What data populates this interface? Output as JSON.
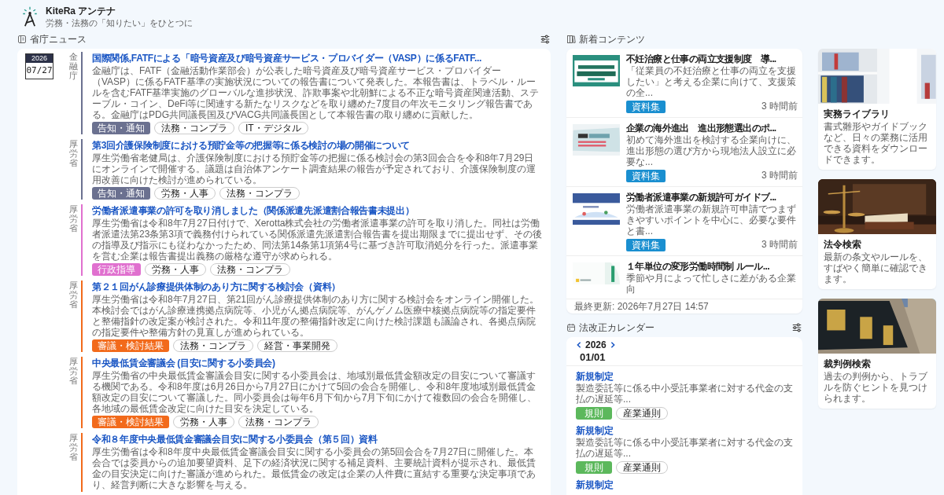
{
  "header": {
    "title": "KiteRa アンテナ",
    "subtitle": "労務・法務の「知りたい」をひとつに"
  },
  "news": {
    "heading": "省庁ニュース",
    "items": [
      {
        "date": {
          "year": "2026",
          "day": "07/27"
        },
        "agency": "金融庁",
        "color": "#6b7190",
        "title": "国際関係,FATFによる「暗号資産及び暗号資産サービス・プロバイダー（VASP）に係るFATF...",
        "summary": "金融庁は、FATF（金融活動作業部会）が公表した暗号資産及び暗号資産サービス・プロバイダー（VASP）に係るFATF基準の実施状況についての報告書について発表した。本報告書は、トラベル・ルールを含むFATF基準実施のグローバルな進捗状況、詐欺事案や北朝鮮による不正な暗号資産関連活動、ステーブル・コイン、DeFi等に関連する新たなリスクなどを取り纏めた7度目の年次モニタリング報告書である。金融庁はPDG共同議長国及びVACG共同議長国として本報告書の取り纏めに貢献した。",
        "tags": [
          {
            "label": "告知・通知",
            "kind": "category"
          },
          {
            "label": "法務・コンプラ",
            "kind": "topic"
          },
          {
            "label": "IT・デジタル",
            "kind": "topic"
          }
        ]
      },
      {
        "agency": "厚労省",
        "color": "#6b7190",
        "title": "第3回介護保険制度における預貯金等の把握等に係る検討の場の開催について",
        "summary": "厚生労働省老健局は、介護保険制度における預貯金等の把握に係る検討会の第3回会合を令和8年7月29日にオンラインで開催する。議題は自治体アンケート調査結果の報告が予定されており、介護保険制度の運用改善に向けた検討が進められている。",
        "tags": [
          {
            "label": "告知・通知",
            "kind": "category"
          },
          {
            "label": "労務・人事",
            "kind": "topic"
          },
          {
            "label": "法務・コンプラ",
            "kind": "topic"
          }
        ]
      },
      {
        "agency": "厚労省",
        "color": "#e070cf",
        "title": "労働者派遣事業の許可を取り消しました（関係派遣先派遣割合報告書未提出）",
        "summary": "厚生労働省は令和8年7月27日付けで、Xerotta株式会社の労働者派遣事業の許可を取り消した。同社は労働者派遣法第23条第3項で義務付けられている関係派遣先派遣割合報告書を提出期限までに提出せず、その後の指導及び指示にも従わなかったため、同法第14条第1項第4号に基づき許可取消処分を行った。派遣事業を営む企業は報告書提出義務の厳格な遵守が求められる。",
        "tags": [
          {
            "label": "行政指導",
            "kind": "category"
          },
          {
            "label": "労務・人事",
            "kind": "topic"
          },
          {
            "label": "法務・コンプラ",
            "kind": "topic"
          }
        ]
      },
      {
        "agency": "厚労省",
        "color": "#f26a1b",
        "title": "第２１回がん診療提供体制のあり方に関する検討会（資料）",
        "summary": "厚生労働省は令和8年7月27日、第21回がん診療提供体制のあり方に関する検討会をオンライン開催した。本検討会ではがん診療連携拠点病院等、小児がん拠点病院等、がんゲノム医療中核拠点病院等の指定要件と整備指針の改定案が検討された。令和11年度の整備指針改定に向けた検討課題も議論され、各拠点病院の指定要件や整備方針の見直しが進められている。",
        "tags": [
          {
            "label": "審議・検討結果",
            "kind": "category"
          },
          {
            "label": "法務・コンプラ",
            "kind": "topic"
          },
          {
            "label": "経営・事業開発",
            "kind": "topic"
          }
        ]
      },
      {
        "agency": "厚労省",
        "color": "#f26a1b",
        "title": "中央最低賃金審議会 (目安に関する小委員会)",
        "summary": "厚生労働省の中央最低賃金審議会目安に関する小委員会は、地域別最低賃金額改定の目安について審議する機関である。令和8年度は6月26日から7月27日にかけて5回の会合を開催し、令和8年度地域別最低賃金額改定の目安について審議した。同小委員会は毎年6月下旬から7月下旬にかけて複数回の会合を開催し、各地域の最低賃金改定に向けた目安を決定している。",
        "tags": [
          {
            "label": "審議・検討結果",
            "kind": "category"
          },
          {
            "label": "労務・人事",
            "kind": "topic"
          },
          {
            "label": "法務・コンプラ",
            "kind": "topic"
          }
        ]
      },
      {
        "agency": "厚労省",
        "color": "#f26a1b",
        "title": "令和８年度中央最低賃金審議会目安に関する小委員会（第５回）資料",
        "summary": "厚生労働省は令和8年度中央最低賃金審議会目安に関する小委員会の第5回会合を7月27日に開催した。本会合では委員からの追加要望資料、足下の経済状況に関する補足資料、主要統計資料が提示され、最低賃金の目安決定に向けた審議が進められた。最低賃金の改定は企業の人件費に直結する重要な決定事項であり、経営判断に大きな影響を与える。"
      }
    ]
  },
  "contents": {
    "heading": "新着コンテンツ",
    "items": [
      {
        "title": "不妊治療と仕事の両立支援制度　導...",
        "summary": "「従業員の不妊治療と仕事の両立を支援したい」と考える企業に向けて、支援策の全...",
        "tag": "資料集",
        "time": "3 時間前"
      },
      {
        "title": "企業の海外進出　進出形態選出のポ...",
        "summary": "初めて海外進出を検討する企業向けに、進出形態の選び方から現地法人設立に必要な...",
        "tag": "資料集",
        "time": "3 時間前"
      },
      {
        "title": "労働者派遣事業の新規許可ガイドブ...",
        "summary": "労働者派遣事業の新規許可申請でつまずきやすいポイントを中心に、必要な要件と書...",
        "tag": "資料集",
        "time": "3 時間前"
      },
      {
        "title": "１年単位の変形労働時間制 ルール...",
        "summary": "季節や月によって忙しさに差がある企業向"
      }
    ],
    "updated": "最終更新: 2026年7月27日 14:57"
  },
  "calendar": {
    "heading": "法改正カレンダー",
    "year": "2026",
    "date": "01/01",
    "entries": [
      {
        "title": "新規制定",
        "summary": "製造委託等に係る中小受託事業者に対する代金の支払の遅延等...",
        "tags": [
          {
            "label": "規則",
            "kind": "category"
          },
          {
            "label": "産業通則",
            "kind": "topic"
          }
        ]
      },
      {
        "title": "新規制定",
        "summary": "製造委託等に係る中小受託事業者に対する代金の支払の遅延等...",
        "tags": [
          {
            "label": "規則",
            "kind": "category"
          },
          {
            "label": "産業通則",
            "kind": "topic"
          }
        ]
      },
      {
        "title": "新規制定"
      }
    ]
  },
  "services": [
    {
      "title": "実務ライブラリ",
      "description": "書式雛形やガイドブックなど、日々の業務に活用できる資料をダウンロードできます。"
    },
    {
      "title": "法令検索",
      "description": "最新の条文やルールを、すばやく簡単に確認できます。"
    },
    {
      "title": "裁判例検索",
      "description": "過去の判例から、トラブルを防ぐヒントを見つけられます。"
    }
  ]
}
